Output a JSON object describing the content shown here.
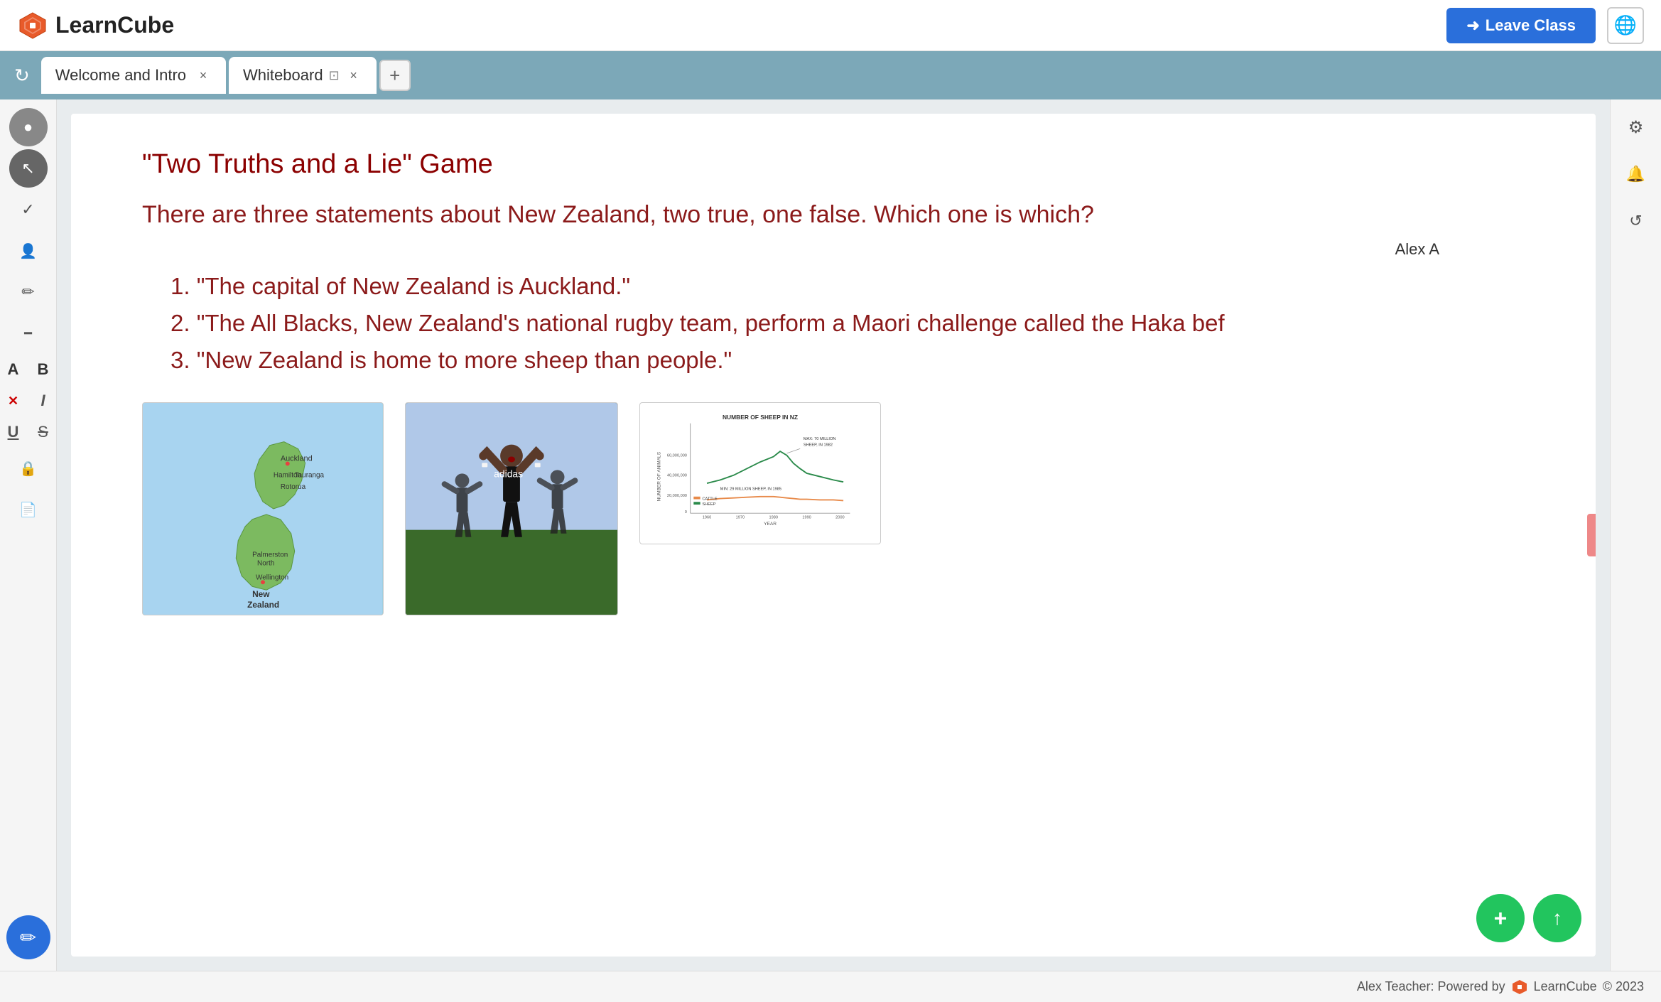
{
  "header": {
    "logo_text": "LearnCube",
    "leave_class_label": "Leave Class",
    "globe_icon": "🌐"
  },
  "tabs": {
    "reload_icon": "↻",
    "tab1_label": "Welcome and Intro",
    "tab2_label": "Whiteboard",
    "add_tab_icon": "+",
    "close_icon": "×",
    "popout_icon": "⊡"
  },
  "toolbar": {
    "record_icon": "●",
    "cursor_icon": "↖",
    "check_icon": "✓",
    "people_icon": "👤",
    "pencil_icon": "✏",
    "ruler_icon": "📏",
    "text_a_icon": "A",
    "text_b_icon": "B",
    "eraser_icon": "⊗",
    "text_italic": "I",
    "text_underline": "U",
    "strikethrough_icon": "S",
    "lock_icon": "🔒",
    "file_icon": "📄",
    "draw_icon": "✏"
  },
  "right_sidebar": {
    "settings_icon": "⚙",
    "bell_icon": "🔔",
    "history_icon": "↺"
  },
  "whiteboard": {
    "title": "\"Two Truths and a Lie\" Game",
    "subtitle": "There are three statements about New Zealand, two true, one false. Which one is which?",
    "attribution": "Alex A",
    "items": [
      "1. \"The capital of New Zealand is Auckland.\"",
      "2. \"The All Blacks, New Zealand's national rugby team, perform a Maori challenge called the Haka bef",
      "3. \"New Zealand is home to more sheep than people.\""
    ],
    "chart_title": "NUMBER OF SHEEP IN NZ",
    "chart_y_label": "NUMBER OF ANIMALS",
    "chart_x_label": "YEAR",
    "chart_legend": [
      "CATTLE",
      "SHEEP"
    ],
    "chart_annotation1": "MAX: 70 MILLION\nSHEEP, IN 1982",
    "chart_annotation2": "MIN: 29 MILLION SHEEP, IN 1985"
  },
  "action_buttons": {
    "add_icon": "+",
    "upload_icon": "↑"
  },
  "bottom_bar": {
    "text": "Alex Teacher: Powered by",
    "brand": "LearnCube",
    "copyright": "© 2023"
  },
  "colors": {
    "accent_red": "#8b0000",
    "accent_blue": "#2a6fdb",
    "accent_green": "#22c55e",
    "tab_bar_bg": "#7ca8b8",
    "header_bg": "#ffffff"
  }
}
